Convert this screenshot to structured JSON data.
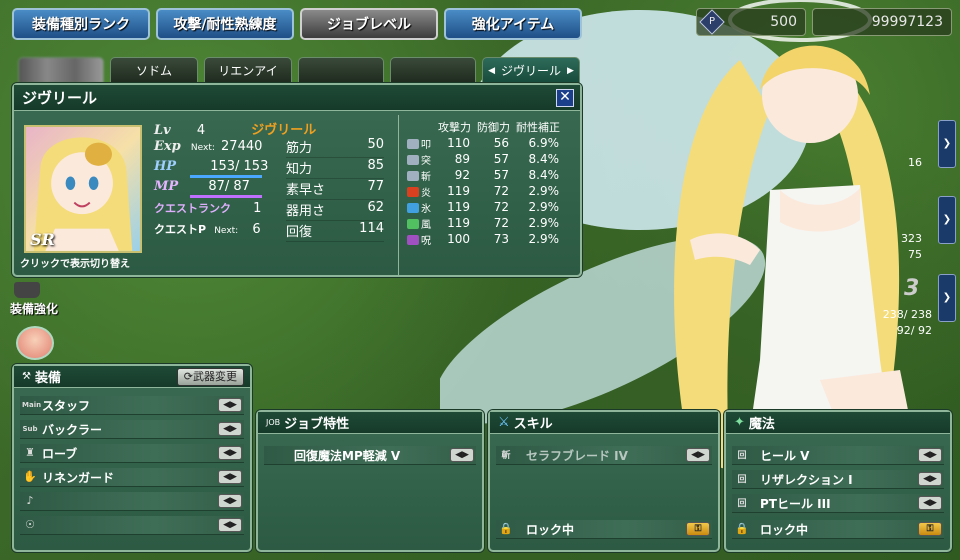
{
  "top_tabs": [
    "装備種別ランク",
    "攻撃/耐性熟練度",
    "ジョブレベル",
    "強化アイテム"
  ],
  "resources": {
    "p_label": "P",
    "points": "500",
    "gold": "99997123"
  },
  "char_tabs": [
    "",
    "ソドム",
    "リエンアイ",
    "",
    "",
    "ジヴリール"
  ],
  "char_tab_arrow_left": "◀",
  "char_tab_arrow_right": "▶",
  "status": {
    "name": "ジヴリール",
    "close": "✕",
    "rarity": "SR",
    "portrait_caption": "クリックで表示切り替え",
    "lv_label": "Lv",
    "lv": "4",
    "name_small": "ジヴリール",
    "exp_label": "Exp",
    "next_label": "Next:",
    "exp_next": "27440",
    "hp_label": "HP",
    "hp": "153/ 153",
    "mp_label": "MP",
    "mp": "87/ 87",
    "quest_rank_label": "クエストランク",
    "quest_rank": "1",
    "quest_p_label": "クエストP",
    "quest_p_next": "Next:",
    "quest_p": "6",
    "stats": [
      {
        "label": "筋力",
        "value": "50"
      },
      {
        "label": "知力",
        "value": "85"
      },
      {
        "label": "素早さ",
        "value": "77"
      },
      {
        "label": "器用さ",
        "value": "62"
      },
      {
        "label": "回復",
        "value": "114"
      }
    ]
  },
  "resist": {
    "headers": [
      "攻撃力",
      "防御力",
      "耐性補正"
    ],
    "rows": [
      {
        "el": "叩",
        "color": "#a0b0c0",
        "atk": "110",
        "def": "56",
        "res": "6.9%"
      },
      {
        "el": "突",
        "color": "#a0b0c0",
        "atk": "89",
        "def": "57",
        "res": "8.4%"
      },
      {
        "el": "斬",
        "color": "#a0b0c0",
        "atk": "92",
        "def": "57",
        "res": "8.4%"
      },
      {
        "el": "炎",
        "color": "#d84020",
        "atk": "119",
        "def": "72",
        "res": "2.9%"
      },
      {
        "el": "氷",
        "color": "#40a0e0",
        "atk": "119",
        "def": "72",
        "res": "2.9%"
      },
      {
        "el": "風",
        "color": "#50c060",
        "atk": "119",
        "def": "72",
        "res": "2.9%"
      },
      {
        "el": "呪",
        "color": "#a050c0",
        "atk": "100",
        "def": "73",
        "res": "2.9%"
      }
    ]
  },
  "side": {
    "enhance_label": "装備強化"
  },
  "party": [
    {
      "num": "",
      "hp": "16",
      "mp": ""
    },
    {
      "num": "",
      "hp": "323",
      "mp": "75"
    },
    {
      "num": "3",
      "hp": "238/ 238",
      "mp": "92/ 92"
    }
  ],
  "equipment": {
    "title": "装備",
    "change_weapon": "武器変更",
    "slots": [
      {
        "icon": "Main",
        "label": "スタッフ"
      },
      {
        "icon": "Sub",
        "label": "バックラー"
      },
      {
        "icon": "",
        "label": "ローブ"
      },
      {
        "icon": "",
        "label": "リネンガード"
      },
      {
        "icon": "",
        "label": ""
      },
      {
        "icon": "",
        "label": ""
      }
    ],
    "toggle": "◀▶"
  },
  "job": {
    "title": "ジョブ特性",
    "tag": "JOB",
    "items": [
      "回復魔法MP軽減 V"
    ]
  },
  "skill": {
    "title": "スキル",
    "items": [
      {
        "tag": "斬",
        "label": "セラフブレード IV"
      }
    ],
    "locked": "ロック中"
  },
  "magic": {
    "title": "魔法",
    "items": [
      {
        "tag": "回",
        "label": "ヒール V"
      },
      {
        "tag": "回",
        "label": "リザレクション I"
      },
      {
        "tag": "回",
        "label": "PTヒール III"
      }
    ],
    "locked": "ロック中"
  }
}
